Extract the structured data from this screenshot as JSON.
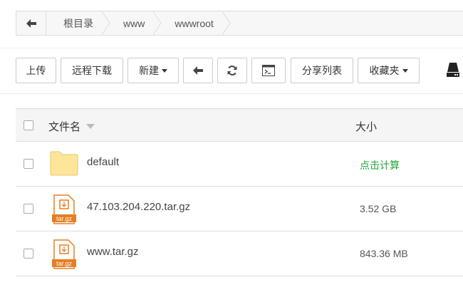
{
  "breadcrumb": {
    "items": [
      "根目录",
      "www",
      "wwwroot"
    ]
  },
  "toolbar": {
    "upload": "上传",
    "remote_download": "远程下载",
    "new": "新建",
    "share_list": "分享列表",
    "favorites": "收藏夹"
  },
  "table": {
    "col_name": "文件名",
    "col_size": "大小",
    "rows": [
      {
        "name": "default",
        "size": "点击计算",
        "type": "folder"
      },
      {
        "name": "47.103.204.220.tar.gz",
        "size": "3.52 GB",
        "type": "archive"
      },
      {
        "name": "www.tar.gz",
        "size": "843.36 MB",
        "type": "archive"
      }
    ],
    "archive_label": "tar.gz"
  },
  "colors": {
    "accent_green": "#20a53a",
    "folder_yellow": "#fde69a",
    "archive_orange": "#e67e22"
  }
}
